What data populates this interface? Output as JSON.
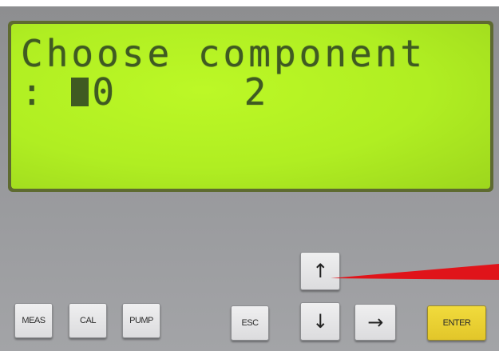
{
  "display": {
    "line1": "Choose component",
    "line2_prefix": ":",
    "line2_value": "0",
    "line2_extra": "2"
  },
  "keys": {
    "up_icon": "arrow-up",
    "down_icon": "arrow-down",
    "right_icon": "arrow-right",
    "meas": "MEAS",
    "cal": "CAL",
    "pump": "PUMP",
    "esc": "ESC",
    "enter": "ENTER",
    "up": "↑",
    "down": "↓",
    "right": "→"
  },
  "colors": {
    "lcd": "#b4f224",
    "lcd_text": "#3f5a22",
    "panel": "#96979a",
    "enter": "#e6cb2e",
    "pointer": "#e0141a"
  }
}
